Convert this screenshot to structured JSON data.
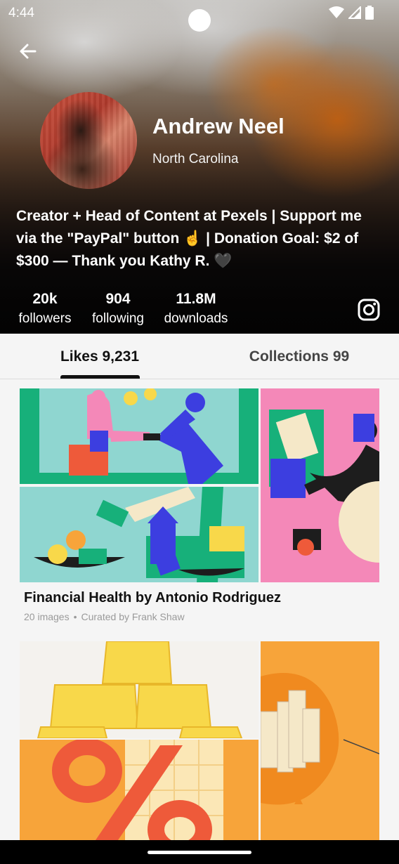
{
  "status": {
    "time": "4:44"
  },
  "profile": {
    "name": "Andrew Neel",
    "location": "North Carolina",
    "bio": "Creator + Head of Content at Pexels  |  Support me via the \"PayPal\" button ☝️  |  Donation Goal: $2 of $300 — Thank you Kathy R. 🖤"
  },
  "stats": [
    {
      "value": "20k",
      "label": "followers"
    },
    {
      "value": "904",
      "label": "following"
    },
    {
      "value": "11.8M",
      "label": "downloads"
    }
  ],
  "tabs": {
    "likes": "Likes 9,231",
    "collections": "Collections 99"
  },
  "collections": [
    {
      "title": "Financial Health by Antonio Rodriguez",
      "count": "20 images",
      "separator": "•",
      "curator": "Curated by Frank Shaw"
    }
  ],
  "colors": {
    "mint": "#8fd6d0",
    "green": "#17b07a",
    "pink": "#f488b8",
    "blue": "#3c3ee0",
    "orange": "#f7a43a",
    "red": "#ee5a3a",
    "yellow": "#f8d84a"
  },
  "icons": [
    "back-arrow-icon",
    "wifi-icon",
    "signal-icon",
    "battery-icon",
    "instagram-icon"
  ]
}
